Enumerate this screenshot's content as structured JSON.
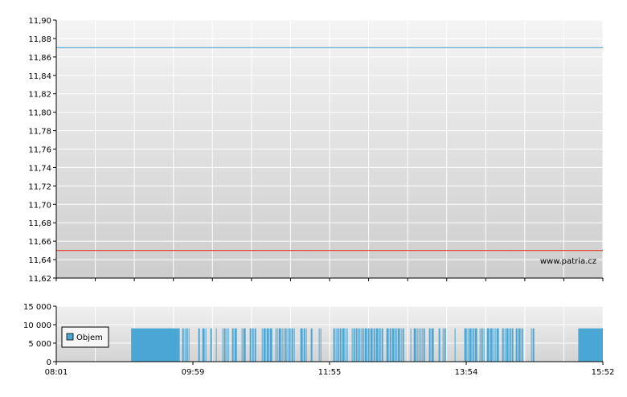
{
  "watermark": "www.patria.cz",
  "chart_data": [
    {
      "type": "line",
      "ylim": [
        11.62,
        11.9
      ],
      "y_ticks": [
        "11,62",
        "11,64",
        "11,66",
        "11,68",
        "11,70",
        "11,72",
        "11,74",
        "11,76",
        "11,78",
        "11,80",
        "11,82",
        "11,84",
        "11,86",
        "11,88",
        "11,90"
      ],
      "grid": true,
      "series": [
        {
          "values": [
            11.87,
            11.87
          ],
          "color": "#5aaed8"
        },
        {
          "values": [
            11.65,
            11.65
          ],
          "color": "#e0493c"
        }
      ]
    },
    {
      "type": "bar",
      "ylim": [
        0,
        15000
      ],
      "y_ticks": [
        "0",
        "5 000",
        "10 000",
        "15 000"
      ],
      "x_ticks": [
        "08:01",
        "09:59",
        "11:55",
        "13:54",
        "15:52"
      ],
      "legend": "Objem",
      "legend_position": "top-left",
      "grid": true,
      "color": "#4aa6d4",
      "bar_value": 9000,
      "bar_segments": [
        [
          0.137,
          0.223
        ],
        [
          0.223,
          0.875
        ],
        [
          0.955,
          1.0
        ]
      ]
    }
  ]
}
